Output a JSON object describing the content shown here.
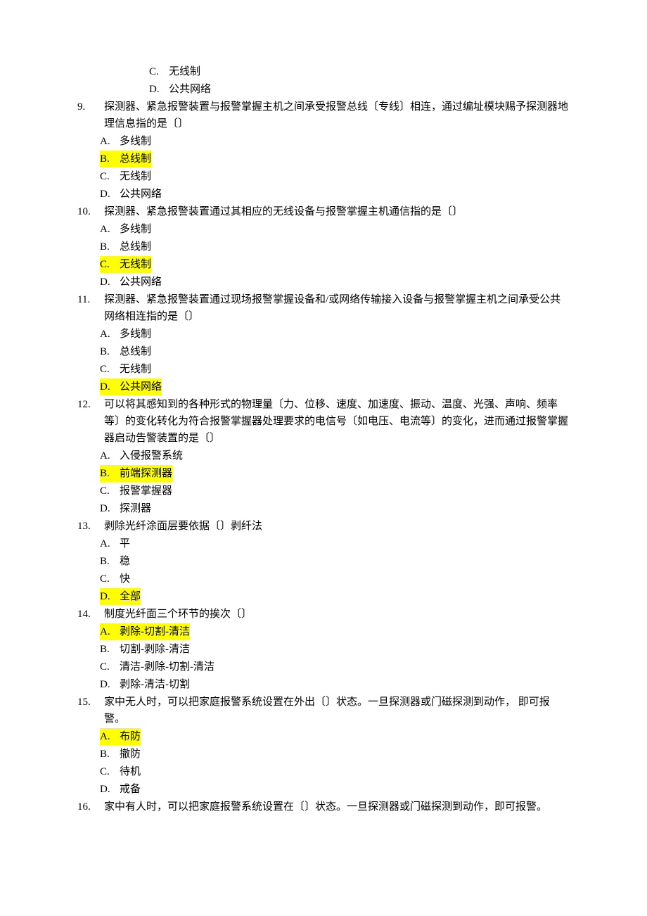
{
  "orphan_pre": [
    {
      "letter": "C.",
      "text": "无线制"
    },
    {
      "letter": "D.",
      "text": "公共网络"
    }
  ],
  "questions": [
    {
      "num": "9.",
      "stem": "探测器、紧急报警装置与报警掌握主机之间承受报警总线〔专线〕相连，通过编址模块赐予探测器地理信息指的是〔〕",
      "opts": [
        {
          "letter": "A.",
          "text": "多线制",
          "hl": false
        },
        {
          "letter": "B.",
          "text": "总线制",
          "hl": true
        },
        {
          "letter": "C.",
          "text": "无线制",
          "hl": false
        },
        {
          "letter": "D.",
          "text": "公共网络",
          "hl": false
        }
      ]
    },
    {
      "num": "10.",
      "stem": "探测器、紧急报警装置通过其相应的无线设备与报警掌握主机通信指的是〔〕",
      "opts": [
        {
          "letter": "A.",
          "text": "多线制",
          "hl": false
        },
        {
          "letter": "B.",
          "text": "总线制",
          "hl": false
        },
        {
          "letter": "C.",
          "text": "无线制",
          "hl": true
        },
        {
          "letter": "D.",
          "text": "公共网络",
          "hl": false
        }
      ]
    },
    {
      "num": "11.",
      "stem": "探测器、紧急报警装置通过现场报警掌握设备和/或网络传输接入设备与报警掌握主机之间承受公共网络相连指的是〔〕",
      "opts": [
        {
          "letter": "A.",
          "text": "多线制",
          "hl": false
        },
        {
          "letter": "B.",
          "text": "总线制",
          "hl": false
        },
        {
          "letter": "C.",
          "text": "无线制",
          "hl": false
        },
        {
          "letter": "D.",
          "text": "公共网络",
          "hl": true
        }
      ]
    },
    {
      "num": "12.",
      "stem": "可以将其感知到的各种形式的物理量〔力、位移、速度、加速度、振动、温度、光强、声响、频率等〕的变化转化为符合报警掌握器处理要求的电信号〔如电压、电流等〕的变化，进而通过报警掌握器启动告警装置的是〔〕",
      "opts": [
        {
          "letter": "A.",
          "text": "入侵报警系统",
          "hl": false
        },
        {
          "letter": "B.",
          "text": "前端探测器",
          "hl": true
        },
        {
          "letter": "C.",
          "text": "报警掌握器",
          "hl": false
        },
        {
          "letter": "D.",
          "text": "探测器",
          "hl": false
        }
      ]
    },
    {
      "num": "13.",
      "stem": "剥除光纤涂面层要依据〔〕剥纤法",
      "opts": [
        {
          "letter": "A.",
          "text": "平",
          "hl": false
        },
        {
          "letter": "B.",
          "text": "稳",
          "hl": false
        },
        {
          "letter": "C.",
          "text": "快",
          "hl": false
        },
        {
          "letter": "D.",
          "text": "全部",
          "hl": true
        }
      ]
    },
    {
      "num": "14.",
      "stem": "制度光纤面三个环节的挨次〔〕",
      "opts": [
        {
          "letter": "A.",
          "text": "剥除-切割-清洁",
          "hl": true
        },
        {
          "letter": "B.",
          "text": "切割-剥除-清洁",
          "hl": false
        },
        {
          "letter": "C.",
          "text": "清洁-剥除-切割-清洁",
          "hl": false
        },
        {
          "letter": "D.",
          "text": "剥除-清洁-切割",
          "hl": false
        }
      ]
    },
    {
      "num": "15.",
      "stem": "家中无人时，可以把家庭报警系统设置在外出〔〕状态。一旦探测器或门磁探测到动作，  即可报警。",
      "opts": [
        {
          "letter": "A.",
          "text": "布防",
          "hl": true
        },
        {
          "letter": "B.",
          "text": "撤防",
          "hl": false
        },
        {
          "letter": "C.",
          "text": "待机",
          "hl": false
        },
        {
          "letter": "D.",
          "text": "戒备",
          "hl": false
        }
      ]
    },
    {
      "num": "16.",
      "stem": "家中有人时，可以把家庭报警系统设置在〔〕状态。一旦探测器或门磁探测到动作，即可报警。",
      "opts": []
    }
  ]
}
